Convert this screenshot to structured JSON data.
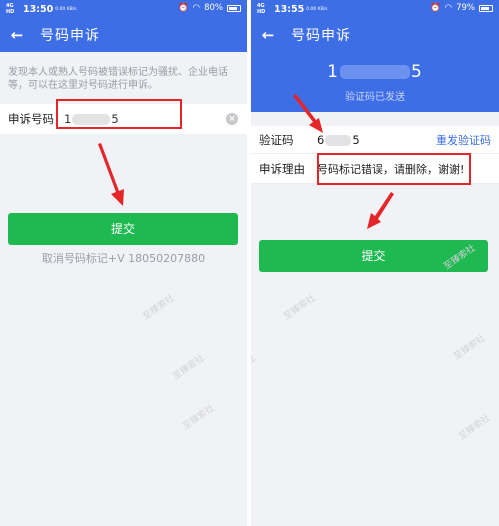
{
  "left": {
    "status": {
      "signal": "4G HD",
      "time": "13:50",
      "speed": "0.00 KB/s",
      "battery": "80%",
      "battery_level": 0.8
    },
    "title": "号码申诉",
    "intro": "发现本人或熟人号码被错误标记为骚扰、企业电话等，可以在这里对号码进行申诉。",
    "field_label": "申诉号码",
    "field_value_start": "1",
    "field_value_end": "5",
    "submit_label": "提交",
    "caption": "取消号码标记+V 18050207880"
  },
  "right": {
    "status": {
      "signal": "4G HD",
      "time": "13:55",
      "speed": "0.00 KB/s",
      "battery": "79%",
      "battery_level": 0.79
    },
    "title": "号码申诉",
    "number_start": "1",
    "number_end": "5",
    "code_sent": "验证码已发送",
    "code_label": "验证码",
    "code_value_start": "6",
    "code_value_end": "5",
    "resend_label": "重发验证码",
    "reason_label": "申诉理由",
    "reason_value": "号码标记错误，请删除，谢谢!",
    "submit_label": "提交"
  },
  "watermark": "至臻索社"
}
